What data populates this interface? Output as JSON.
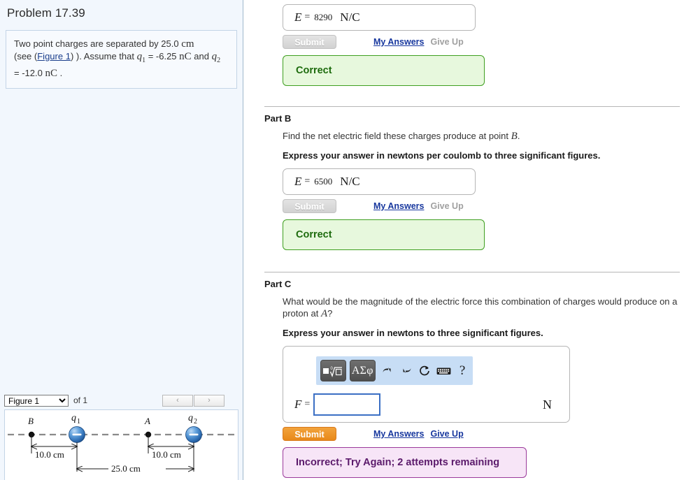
{
  "left": {
    "problem_title": "Problem 17.39",
    "statement": {
      "line1_a": "Two point charges are separated by 25.0 ",
      "line1_unit": "cm",
      "line2_a": "(see (",
      "figure_link": "Figure 1",
      "line2_b": ") ). Assume that ",
      "q1_sym": "q",
      "q1_sub": "1",
      "line2_c": " = -6.25 ",
      "nC_1": "nC",
      "line2_d": " and ",
      "q2_sym": "q",
      "q2_sub": "2",
      "line3_a": " = -12.0 ",
      "nC_2": "nC",
      "line3_b": " ."
    },
    "figure_bar": {
      "selected_figure": "Figure 1",
      "options": [
        "Figure 1"
      ],
      "of_label": "of 1",
      "prev_glyph": "‹",
      "next_glyph": "›"
    },
    "figure": {
      "label_B": "B",
      "label_A": "A",
      "label_q1": "q",
      "label_q1_sub": "1",
      "label_q2": "q",
      "label_q2_sub": "2",
      "dim_left": "10.0 cm",
      "dim_right": "10.0 cm",
      "dim_total": "25.0 cm",
      "charge_sign": "−"
    }
  },
  "parts": [
    {
      "id": "A",
      "show_header": false,
      "label": "",
      "question": "",
      "instruction": "",
      "answer": {
        "lhs": "E",
        "eq": "=",
        "value": "8290",
        "unit": "N/C"
      },
      "submit_label": "Submit",
      "submit_state": "disabled",
      "my_answers_label": "My Answers",
      "give_up_label": "Give Up",
      "give_up_state": "disabled",
      "feedback": {
        "text": "Correct",
        "state": "correct"
      }
    },
    {
      "id": "B",
      "show_header": true,
      "label": "Part B",
      "question_a": "Find the net electric field these charges produce at point ",
      "question_var": "B",
      "question_b": ".",
      "instruction": "Express your answer in newtons per coulomb to three significant figures.",
      "answer": {
        "lhs": "E",
        "eq": "=",
        "value": "6500",
        "unit": "N/C"
      },
      "submit_label": "Submit",
      "submit_state": "disabled",
      "my_answers_label": "My Answers",
      "give_up_label": "Give Up",
      "give_up_state": "disabled",
      "feedback": {
        "text": "Correct",
        "state": "correct"
      }
    },
    {
      "id": "C",
      "show_header": true,
      "label": "Part C",
      "question_a": "What would be the magnitude of the electric force this combination of charges would produce on a proton at ",
      "question_var": "A",
      "question_b": "?",
      "instruction": "Express your answer in newtons to three significant figures.",
      "answer": {
        "lhs": "F",
        "eq": "=",
        "value": "",
        "unit": "N"
      },
      "toolbar": {
        "template_btn": "template-radical",
        "greek_btn": "ΑΣφ",
        "undo": "undo-arrow",
        "redo": "redo-arrow",
        "reset": "reset-arrow",
        "keyboard": "keyboard",
        "help": "?"
      },
      "submit_label": "Submit",
      "submit_state": "active",
      "my_answers_label": "My Answers",
      "give_up_label": "Give Up",
      "give_up_state": "active",
      "feedback": {
        "text": "Incorrect; Try Again; 2 attempts remaining",
        "state": "incorrect"
      }
    }
  ],
  "colors": {
    "left_bg": "#f2f7fd",
    "link_blue": "#17379e",
    "submit_orange": "#e8891a",
    "correct_green": "#1d6b0d",
    "correct_bg": "#e7f8dd",
    "incorrect_purple": "#5b1a6b",
    "incorrect_bg": "#f7e5f7",
    "toolbar_blue": "#c7ddf5",
    "charge_blue": "#3a7fc4"
  }
}
